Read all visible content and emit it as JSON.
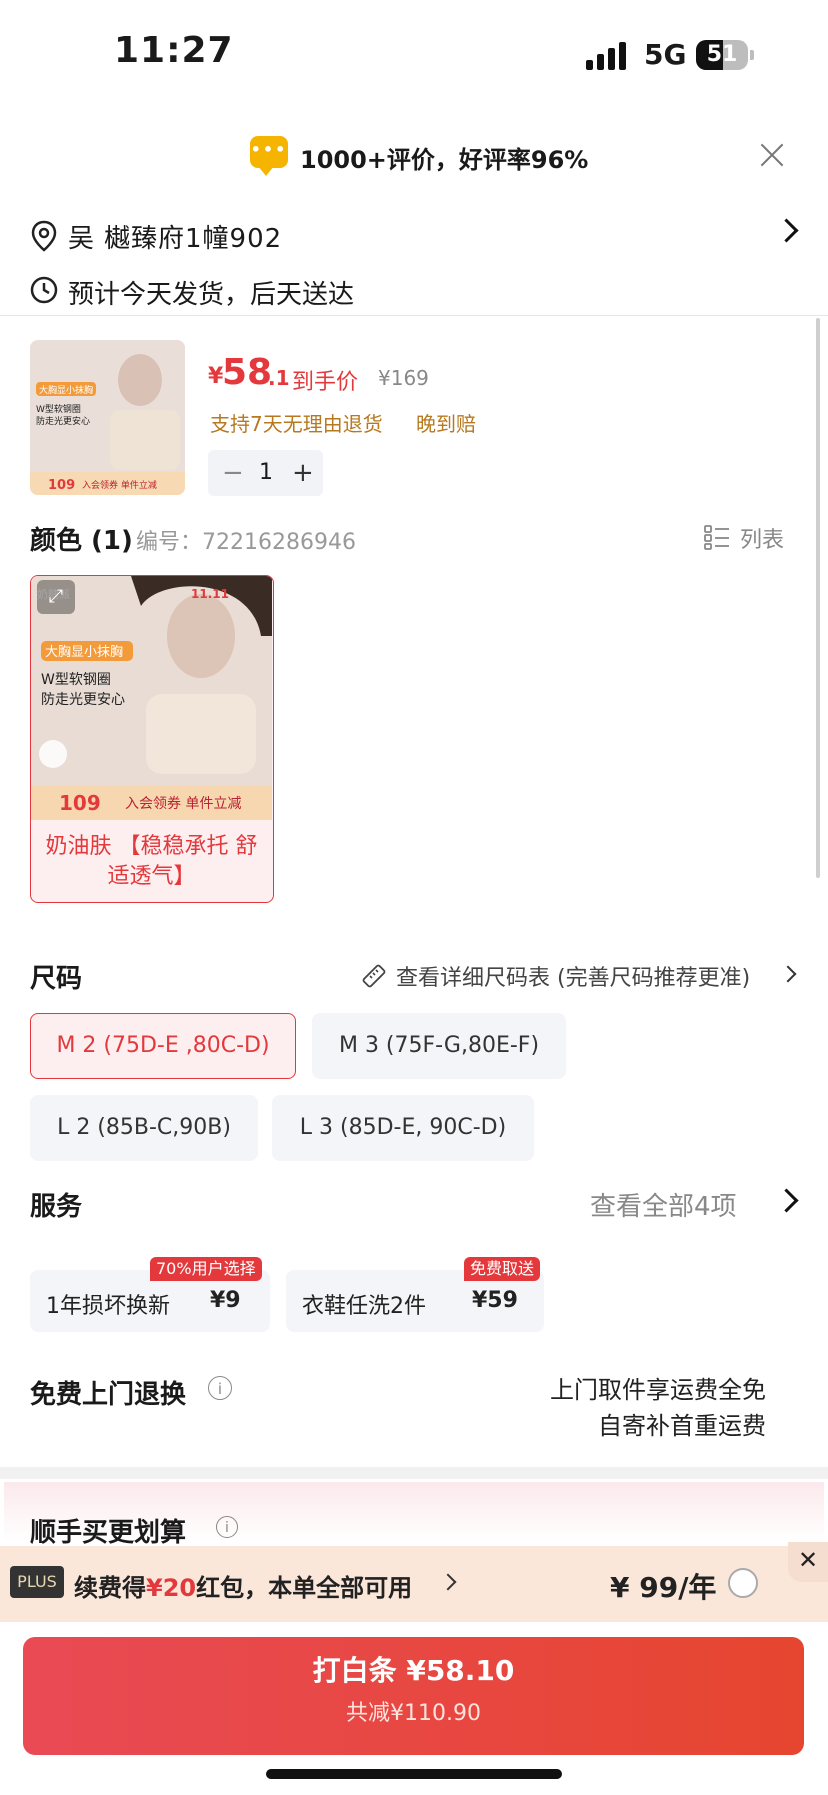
{
  "status_bar": {
    "time": "11:27",
    "network": "5G",
    "battery": "51",
    "battery_level": 0.51
  },
  "review_banner": {
    "text": "1000+评价，好评率96%",
    "icon": "chat-bubble-icon"
  },
  "address": {
    "name": "吴",
    "detail": "樾臻府1幢902"
  },
  "delivery": {
    "text": "预计今天发货，后天送达"
  },
  "product": {
    "price_symbol": "¥",
    "price_integer": "58",
    "price_decimal": ".1",
    "price_label": "到手价",
    "original_price": "¥169",
    "return_policy": "支持7天无理由退货",
    "late_compensation": "晚到赔",
    "quantity": "1",
    "thumb": {
      "tags": [
        "大胸显小抹胸",
        "W型软钢圈",
        "防走光更安心"
      ],
      "price": "109",
      "promo": "入会领券 单件立减"
    }
  },
  "color_section": {
    "title": "颜色 (1)",
    "id_label": "编号：72216286946",
    "list_label": "列表",
    "options": [
      {
        "label": "奶油肤 【稳稳承托 舒适透气】",
        "img_brand": "奶糖派",
        "img_event": "11.11",
        "img_tag": "大胸显小抹胸",
        "img_line1": "W型软钢圈",
        "img_line2": "防走光更安心",
        "img_price": "109",
        "img_promo": "入会领券 单件立减"
      }
    ]
  },
  "size_section": {
    "title": "尺码",
    "chart_link": "查看详细尺码表 (完善尺码推荐更准)",
    "options": [
      {
        "label": "M 2 (75D-E ,80C-D)",
        "selected": true
      },
      {
        "label": "M 3 (75F-G,80E-F)",
        "selected": false
      },
      {
        "label": "L 2 (85B-C,90B)",
        "selected": false
      },
      {
        "label": "L 3 (85D-E, 90C-D)",
        "selected": false
      }
    ]
  },
  "services": {
    "title": "服务",
    "view_all": "查看全部4项",
    "items": [
      {
        "name": "1年损坏换新",
        "price": "¥9",
        "tag": "70%用户选择"
      },
      {
        "name": "衣鞋任洗2件",
        "price": "¥59",
        "tag": "免费取送"
      }
    ]
  },
  "free_return": {
    "title": "免费上门退换",
    "line1": "上门取件享运费全免",
    "line2": "自寄补首重运费"
  },
  "bundle": {
    "title": "顺手买更划算"
  },
  "plus_bar": {
    "badge": "PLUS",
    "text_prefix": "续费得",
    "text_highlight": "¥20",
    "text_suffix": "红包，本单全部可用",
    "price": "¥ 99/年",
    "close": "✕"
  },
  "checkout": {
    "main": "打白条 ¥58.10",
    "sub": "共减¥110.90"
  },
  "colors": {
    "accent": "#e4393c",
    "gold": "#b7791f",
    "review_icon": "#f5b400"
  }
}
